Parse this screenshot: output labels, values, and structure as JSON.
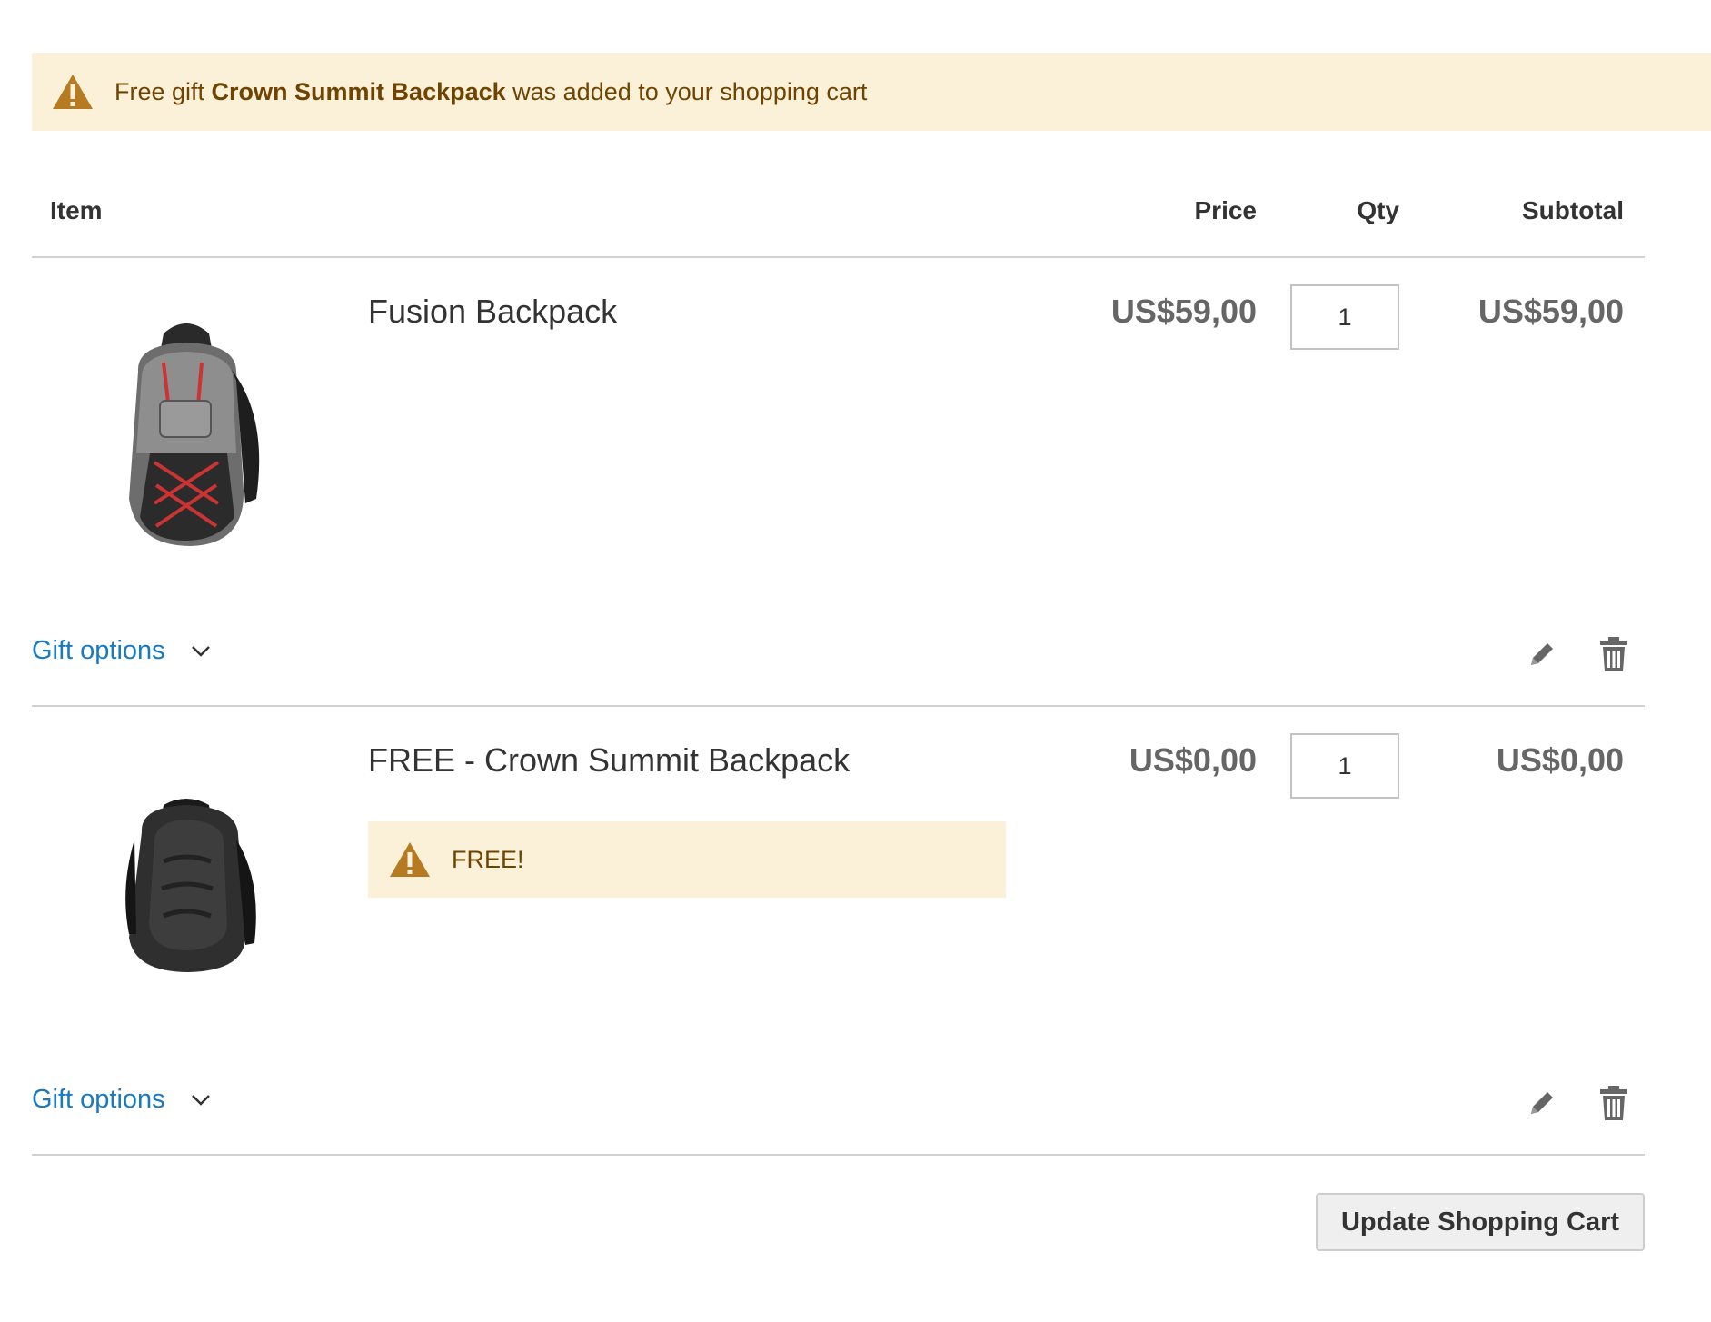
{
  "notice": {
    "prefix": "Free gift ",
    "product": "Crown Summit Backpack",
    "suffix": " was added to your shopping cart",
    "icon": "warning-icon",
    "background": "#fbf0d8",
    "text_color": "#6f4400"
  },
  "table_header": {
    "item": "Item",
    "price": "Price",
    "qty": "Qty",
    "subtotal": "Subtotal"
  },
  "items": [
    {
      "name": "Fusion Backpack",
      "price": "US$59,00",
      "qty": "1",
      "subtotal": "US$59,00",
      "gift_options": "Gift options",
      "image": "grey-backpack-image"
    },
    {
      "name": "FREE - Crown Summit Backpack",
      "price": "US$0,00",
      "qty": "1",
      "subtotal": "US$0,00",
      "gift_options": "Gift options",
      "message": "FREE!",
      "image": "black-backpack-image"
    }
  ],
  "update_button": "Update Shopping Cart",
  "colors": {
    "link": "#1979c3",
    "warning_icon": "#c07f00",
    "divider": "#d1d1d1"
  }
}
